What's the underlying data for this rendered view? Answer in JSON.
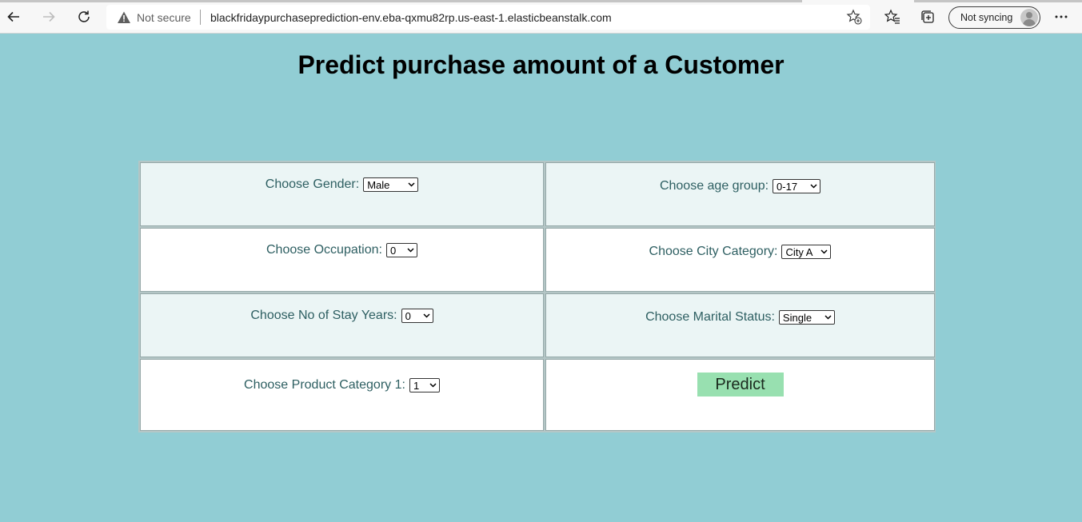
{
  "browser": {
    "security_label": "Not secure",
    "url": "blackfridaypurchaseprediction-env.eba-qxmu82rp.us-east-1.elasticbeanstalk.com",
    "sync_label": "Not syncing"
  },
  "page": {
    "title": "Predict purchase amount of a Customer"
  },
  "form": {
    "gender": {
      "label": "Choose Gender:",
      "value": "Male"
    },
    "age": {
      "label": "Choose age group:",
      "value": "0-17"
    },
    "occupation": {
      "label": "Choose Occupation:",
      "value": "0"
    },
    "city": {
      "label": "Choose City Category:",
      "value": "City A"
    },
    "stay": {
      "label": "Choose No of Stay Years:",
      "value": "0"
    },
    "marital": {
      "label": "Choose Marital Status:",
      "value": "Single"
    },
    "product": {
      "label": "Choose Product Category 1:",
      "value": "1"
    },
    "predict_label": "Predict"
  },
  "colors": {
    "page_background": "#91cdd4",
    "label_text": "#2e5f62",
    "predict_button": "#98e0b0"
  },
  "icons": [
    "back-icon",
    "forward-icon",
    "refresh-icon",
    "warning-icon",
    "add-favorite-icon",
    "favorites-icon",
    "collections-icon",
    "profile-icon",
    "more-icon"
  ]
}
